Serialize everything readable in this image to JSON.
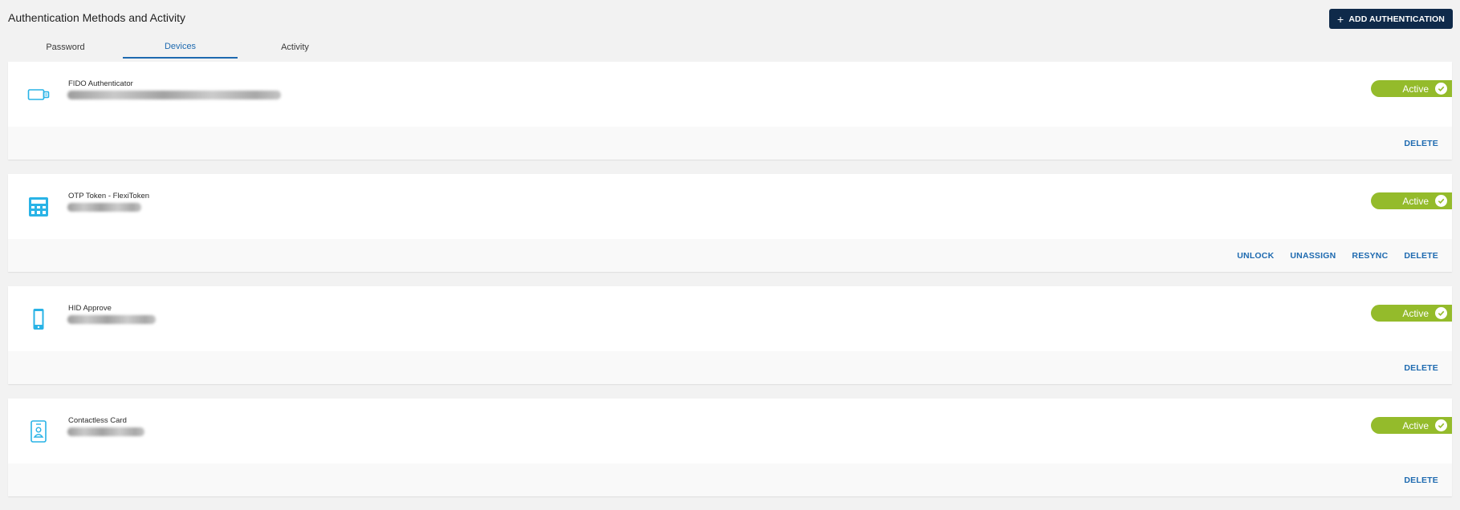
{
  "header": {
    "title": "Authentication Methods and Activity",
    "add_button_label": "ADD AUTHENTICATION"
  },
  "tabs": [
    {
      "label": "Password"
    },
    {
      "label": "Devices"
    },
    {
      "label": "Activity"
    }
  ],
  "devices": [
    {
      "name": "FIDO Authenticator",
      "icon": "security-key-icon",
      "status": "Active",
      "actions": [
        "DELETE"
      ]
    },
    {
      "name": "OTP Token - FlexiToken",
      "icon": "calculator-token-icon",
      "status": "Active",
      "actions": [
        "UNLOCK",
        "UNASSIGN",
        "RESYNC",
        "DELETE"
      ]
    },
    {
      "name": "HID Approve",
      "icon": "smartphone-icon",
      "status": "Active",
      "actions": [
        "DELETE"
      ]
    },
    {
      "name": "Contactless Card",
      "icon": "id-card-icon",
      "status": "Active",
      "actions": [
        "DELETE"
      ]
    }
  ],
  "colors": {
    "accent": "#1e6ab0",
    "primary_button": "#0f2a4a",
    "active_badge": "#94bb2b",
    "icon": "#29b3e6"
  }
}
